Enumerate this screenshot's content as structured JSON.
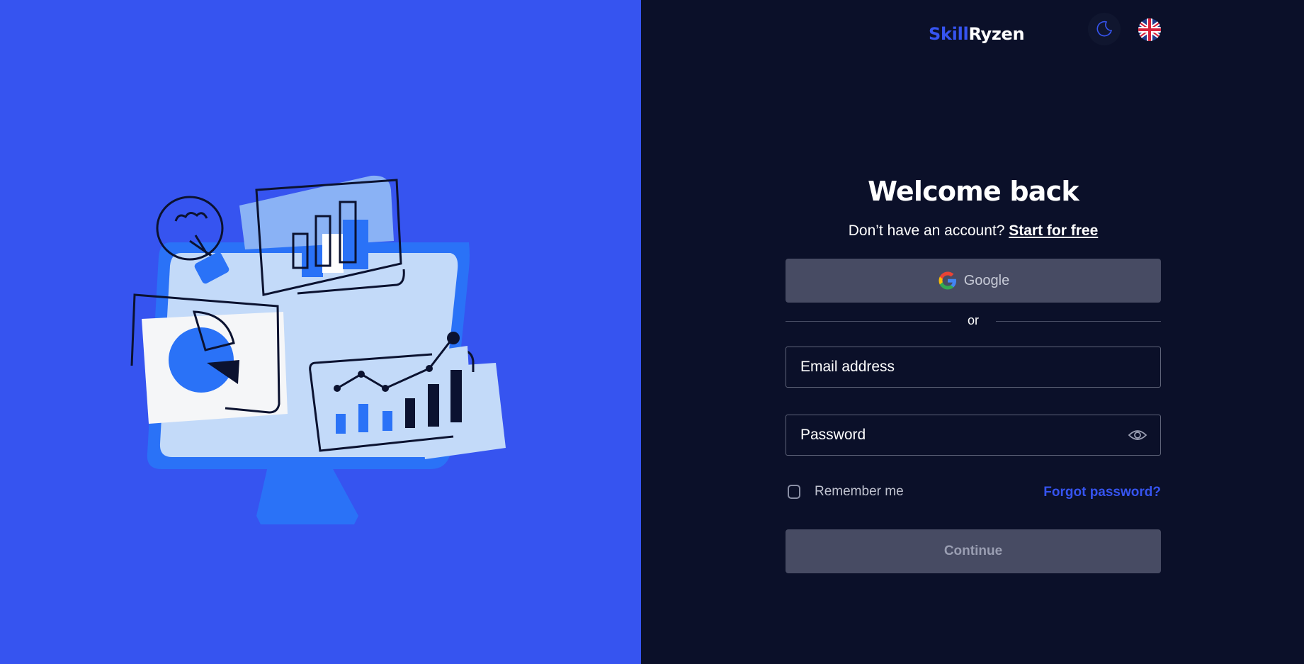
{
  "brand": {
    "part1": "Skill",
    "part2": "Ryzen"
  },
  "header": {
    "theme_icon": "moon-icon",
    "language_icon": "uk-flag-icon"
  },
  "login": {
    "title": "Welcome back",
    "subtitle_text": "Don’t have an account?",
    "signup_link": "Start for free",
    "google_label": "Google",
    "divider_text": "or",
    "email_placeholder": "Email address",
    "password_placeholder": "Password",
    "remember_label": "Remember me",
    "forgot_label": "Forgot password?",
    "continue_label": "Continue"
  },
  "colors": {
    "left_panel_bg": "#3654f0",
    "right_panel_bg": "#0b1029",
    "accent": "#3654f0",
    "button_bg": "#474b63"
  }
}
